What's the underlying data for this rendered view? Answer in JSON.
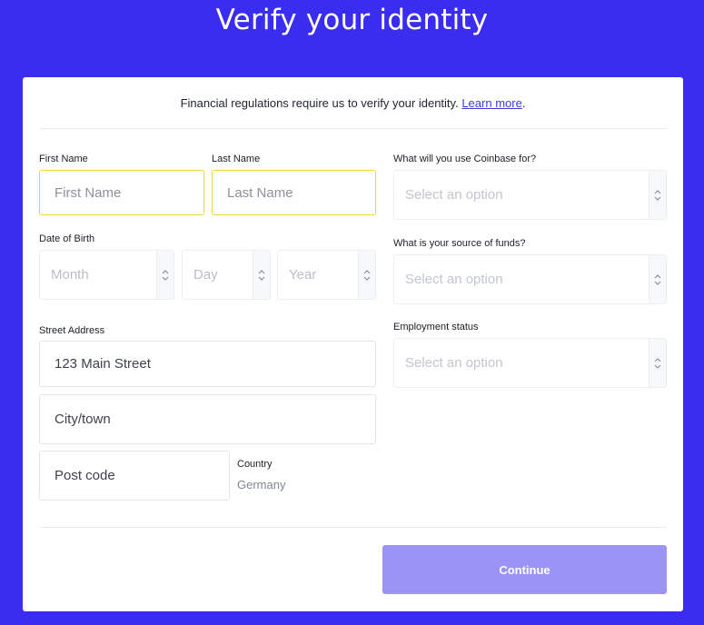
{
  "page_title": "Verify your identity",
  "intro": {
    "text": "Financial regulations require us to verify your identity.",
    "link": "Learn more",
    "suffix": "."
  },
  "form": {
    "first_name": {
      "label": "First Name",
      "placeholder": "First Name"
    },
    "last_name": {
      "label": "Last Name",
      "placeholder": "Last Name"
    },
    "dob": {
      "label": "Date of Birth",
      "month": "Month",
      "day": "Day",
      "year": "Year"
    },
    "street": {
      "label": "Street Address",
      "value": "123 Main Street"
    },
    "city": {
      "placeholder": "City/town"
    },
    "postcode": {
      "placeholder": "Post code"
    },
    "country": {
      "label": "Country",
      "value": "Germany"
    },
    "use": {
      "label": "What will you use Coinbase for?",
      "placeholder": "Select an option"
    },
    "funds": {
      "label": "What is your source of funds?",
      "placeholder": "Select an option"
    },
    "employment": {
      "label": "Employment status",
      "placeholder": "Select an option"
    }
  },
  "continue_label": "Continue",
  "colors": {
    "background": "#3a2df0",
    "button": "#9b94f6",
    "focus_border": "#f1d53f",
    "link": "#3b3cd8"
  },
  "icons": {
    "select": "chevron-up-down-icon"
  }
}
